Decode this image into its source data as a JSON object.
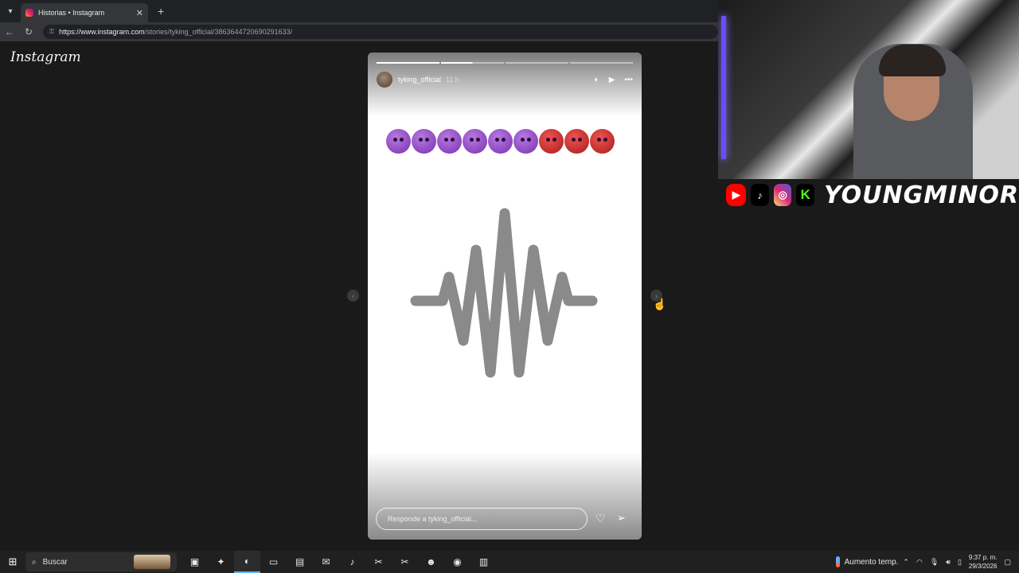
{
  "browser": {
    "tab_title": "Historias • Instagram",
    "tab_close": "✕",
    "new_tab": "+",
    "url_domain": "https://www.instagram.com",
    "url_path": "/stories/tyking_official/3863644720690291633/"
  },
  "page": {
    "logo": "Instagram"
  },
  "story": {
    "username": "tyking_official",
    "time": "11 h",
    "progress": {
      "segments": 4,
      "completed": 1,
      "current_fraction": 0.5
    },
    "emoji_sequence": [
      "smiling-devil",
      "smiling-devil",
      "smiling-devil",
      "smiling-devil",
      "smiling-devil",
      "smiling-devil",
      "ogre",
      "ogre",
      "ogre"
    ],
    "reply_placeholder": "Responde a tyking_official...",
    "wave_color": "#8a8a8a"
  },
  "overlay": {
    "brand": "YOUNGMINOR",
    "socials": [
      "youtube-icon",
      "tiktok-icon",
      "instagram-icon",
      "kick-icon"
    ],
    "kick_letter": "K"
  },
  "taskbar": {
    "search_label": "Buscar",
    "weather": "Aumento temp.",
    "time": "9:37 p. m.",
    "date": "29/3/2026"
  },
  "colors": {
    "accent": "#5ab0ff",
    "youtube": "#ff0000",
    "kick": "#53fc18"
  }
}
